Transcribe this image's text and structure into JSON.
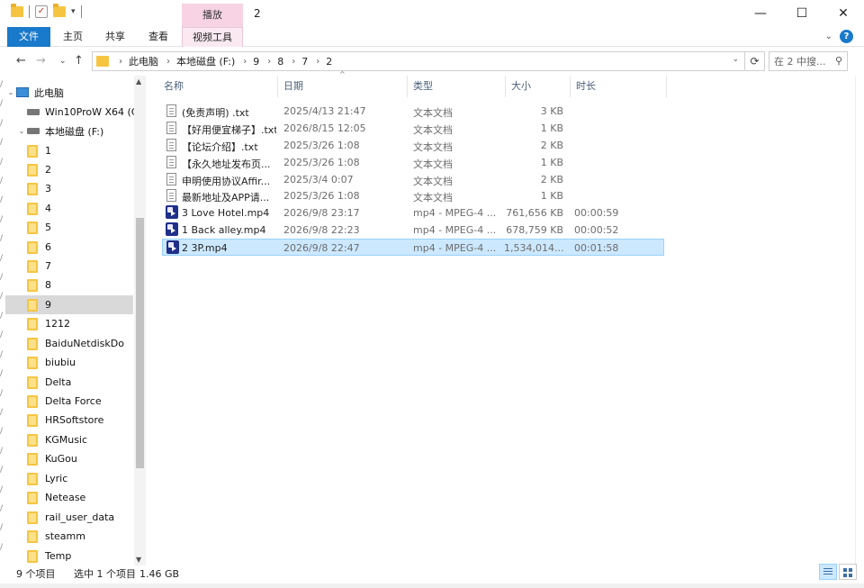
{
  "window": {
    "title": "2",
    "context_tab": "播放",
    "controls": {
      "minimize": "—",
      "maximize": "☐",
      "close": "✕"
    }
  },
  "ribbon": {
    "tabs": {
      "file": "文件",
      "home": "主页",
      "share": "共享",
      "view": "查看",
      "video_tools": "视频工具"
    },
    "expand_glyph": "⌄",
    "help_glyph": "?"
  },
  "nav": {
    "back": "←",
    "forward": "→",
    "recent": "⌄",
    "up": "↑",
    "breadcrumb": [
      "此电脑",
      "本地磁盘 (F:)",
      "9",
      "8",
      "7",
      "2"
    ],
    "refresh": "⟳",
    "search_placeholder": "在 2 中搜...",
    "accent": "#1979ca"
  },
  "sidebar": {
    "items": [
      {
        "label": "此电脑",
        "type": "pc",
        "expanded": true
      },
      {
        "label": "Win10ProW X64 (C",
        "type": "drive"
      },
      {
        "label": "本地磁盘 (F:)",
        "type": "drive",
        "expanded": true
      },
      {
        "label": "1",
        "type": "folder"
      },
      {
        "label": "2",
        "type": "folder"
      },
      {
        "label": "3",
        "type": "folder"
      },
      {
        "label": "4",
        "type": "folder"
      },
      {
        "label": "5",
        "type": "folder"
      },
      {
        "label": "6",
        "type": "folder"
      },
      {
        "label": "7",
        "type": "folder"
      },
      {
        "label": "8",
        "type": "folder"
      },
      {
        "label": "9",
        "type": "folder",
        "selected": true
      },
      {
        "label": "1212",
        "type": "folder"
      },
      {
        "label": "BaiduNetdiskDo",
        "type": "folder"
      },
      {
        "label": "biubiu",
        "type": "folder"
      },
      {
        "label": "Delta",
        "type": "folder"
      },
      {
        "label": "Delta Force",
        "type": "folder"
      },
      {
        "label": "HRSoftstore",
        "type": "folder"
      },
      {
        "label": "KGMusic",
        "type": "folder"
      },
      {
        "label": "KuGou",
        "type": "folder"
      },
      {
        "label": "Lyric",
        "type": "folder"
      },
      {
        "label": "Netease",
        "type": "folder"
      },
      {
        "label": "rail_user_data",
        "type": "folder"
      },
      {
        "label": "steamm",
        "type": "folder"
      },
      {
        "label": "Temp",
        "type": "folder"
      }
    ]
  },
  "columns": {
    "name": "名称",
    "date": "日期",
    "type": "类型",
    "size": "大小",
    "duration": "时长"
  },
  "files": [
    {
      "name": "(免责声明) .txt",
      "date": "2025/4/13 21:47",
      "type": "文本文档",
      "size": "3 KB",
      "duration": "",
      "icon": "text-file-icon"
    },
    {
      "name": "【好用便宜梯子】.txt",
      "date": "2026/8/15 12:05",
      "type": "文本文档",
      "size": "1 KB",
      "duration": "",
      "icon": "text-file-icon"
    },
    {
      "name": "【论坛介绍】.txt",
      "date": "2025/3/26 1:08",
      "type": "文本文档",
      "size": "2 KB",
      "duration": "",
      "icon": "text-file-icon"
    },
    {
      "name": "【永久地址发布页...",
      "date": "2025/3/26 1:08",
      "type": "文本文档",
      "size": "1 KB",
      "duration": "",
      "icon": "text-file-icon"
    },
    {
      "name": "申明使用协议Affir...",
      "date": "2025/3/4 0:07",
      "type": "文本文档",
      "size": "2 KB",
      "duration": "",
      "icon": "text-file-icon"
    },
    {
      "name": "最新地址及APP请...",
      "date": "2025/3/26 1:08",
      "type": "文本文档",
      "size": "1 KB",
      "duration": "",
      "icon": "text-file-icon"
    },
    {
      "name": "3 Love Hotel.mp4",
      "date": "2026/9/8 23:17",
      "type": "mp4 - MPEG-4 ...",
      "size": "761,656 KB",
      "duration": "00:00:59",
      "icon": "video-file-icon"
    },
    {
      "name": "1 Back alley.mp4",
      "date": "2026/9/8 22:23",
      "type": "mp4 - MPEG-4 ...",
      "size": "678,759 KB",
      "duration": "00:00:52",
      "icon": "video-file-icon"
    },
    {
      "name": "2 3P.mp4",
      "date": "2026/9/8 22:47",
      "type": "mp4 - MPEG-4 ...",
      "size": "1,534,014...",
      "duration": "00:01:58",
      "icon": "video-file-icon",
      "selected": true
    }
  ],
  "status": {
    "item_count": "9 个项目",
    "selected": "选中 1 个项目",
    "selected_size": "1.46 GB"
  }
}
